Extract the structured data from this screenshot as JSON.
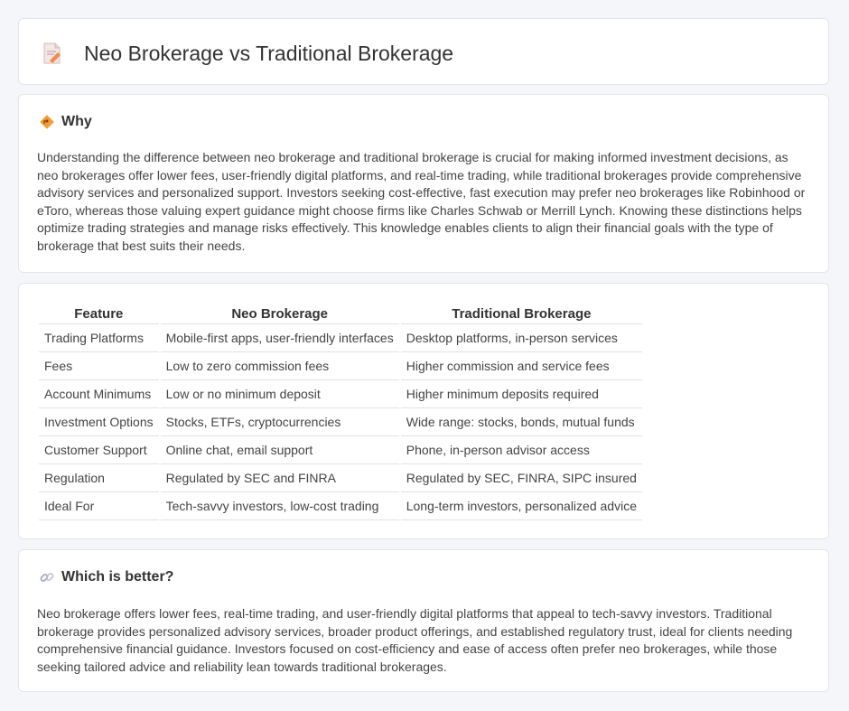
{
  "header": {
    "title": "Neo Brokerage vs Traditional Brokerage",
    "icon": "document-pencil-icon"
  },
  "why": {
    "title": "Why",
    "icon": "road-sign-icon",
    "text": "Understanding the difference between neo brokerage and traditional brokerage is crucial for making informed investment decisions, as neo brokerages offer lower fees, user-friendly digital platforms, and real-time trading, while traditional brokerages provide comprehensive advisory services and personalized support. Investors seeking cost-effective, fast execution may prefer neo brokerages like Robinhood or eToro, whereas those valuing expert guidance might choose firms like Charles Schwab or Merrill Lynch. Knowing these distinctions helps optimize trading strategies and manage risks effectively. This knowledge enables clients to align their financial goals with the type of brokerage that best suits their needs."
  },
  "table": {
    "headers": [
      "Feature",
      "Neo Brokerage",
      "Traditional Brokerage"
    ],
    "rows": [
      [
        "Trading Platforms",
        "Mobile-first apps, user-friendly interfaces",
        "Desktop platforms, in-person services"
      ],
      [
        "Fees",
        "Low to zero commission fees",
        "Higher commission and service fees"
      ],
      [
        "Account Minimums",
        "Low or no minimum deposit",
        "Higher minimum deposits required"
      ],
      [
        "Investment Options",
        "Stocks, ETFs, cryptocurrencies",
        "Wide range: stocks, bonds, mutual funds"
      ],
      [
        "Customer Support",
        "Online chat, email support",
        "Phone, in-person advisor access"
      ],
      [
        "Regulation",
        "Regulated by SEC and FINRA",
        "Regulated by SEC, FINRA, SIPC insured"
      ],
      [
        "Ideal For",
        "Tech-savvy investors, low-cost trading",
        "Long-term investors, personalized advice"
      ]
    ]
  },
  "better": {
    "title": "Which is better?",
    "icon": "link-icon",
    "text": "Neo brokerage offers lower fees, real-time trading, and user-friendly digital platforms that appeal to tech-savvy investors. Traditional brokerage provides personalized advisory services, broader product offerings, and established regulatory trust, ideal for clients needing comprehensive financial guidance. Investors focused on cost-efficiency and ease of access often prefer neo brokerages, while those seeking tailored advice and reliability lean towards traditional brokerages."
  },
  "colors": {
    "background": "#f5f6fa",
    "card": "#ffffff",
    "border": "#e3e5ec",
    "accent_orange": "#f29b38"
  }
}
